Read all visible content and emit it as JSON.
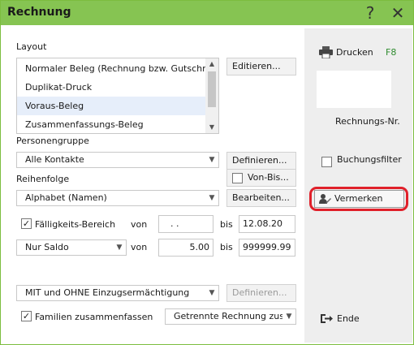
{
  "window": {
    "title": "Rechnung",
    "help_icon": "?",
    "close_icon": "✕"
  },
  "layout": {
    "label": "Layout",
    "items": [
      {
        "label": "Normaler Beleg (Rechnung bzw. Gutschrift)"
      },
      {
        "label": "Duplikat-Druck"
      },
      {
        "label": "Voraus-Beleg",
        "selected": true
      },
      {
        "label": "Zusammenfassungs-Beleg"
      }
    ],
    "edit_button": "Editieren..."
  },
  "personengruppe": {
    "label": "Personengruppe",
    "value": "Alle Kontakte",
    "define_button": "Definieren...",
    "von_bis_label": "Von-Bis..."
  },
  "reihenfolge": {
    "label": "Reihenfolge",
    "value": "Alphabet (Namen)",
    "edit_button": "Bearbeiten..."
  },
  "faelligkeit": {
    "checkbox_label": "Fälligkeits-Bereich",
    "checked": true,
    "von_label": "von",
    "von_value": ". .",
    "bis_label": "bis",
    "bis_value": "12.08.20"
  },
  "saldo": {
    "value": "Nur Saldo",
    "von_label": "von",
    "von_value": "5.00",
    "bis_label": "bis",
    "bis_value": "999999.99"
  },
  "einzug": {
    "value": "MIT und OHNE Einzugsermächtigung",
    "define_button": "Definieren..."
  },
  "familien": {
    "checkbox_label": "Familien zusammenfassen",
    "checked": true,
    "value": "Getrennte Rechnung zusammenfassen"
  },
  "sidebar": {
    "print_label": "Drucken",
    "print_shortcut": "F8",
    "invoice_no_label": "Rechnungs-Nr.",
    "buchungsfilter_label": "Buchungsfilter",
    "vermerken_label": "Vermerken",
    "end_label": "Ende"
  },
  "colors": {
    "titlebar": "#86c452",
    "highlight": "#e0202a",
    "shortcut": "#2e8b2e"
  }
}
